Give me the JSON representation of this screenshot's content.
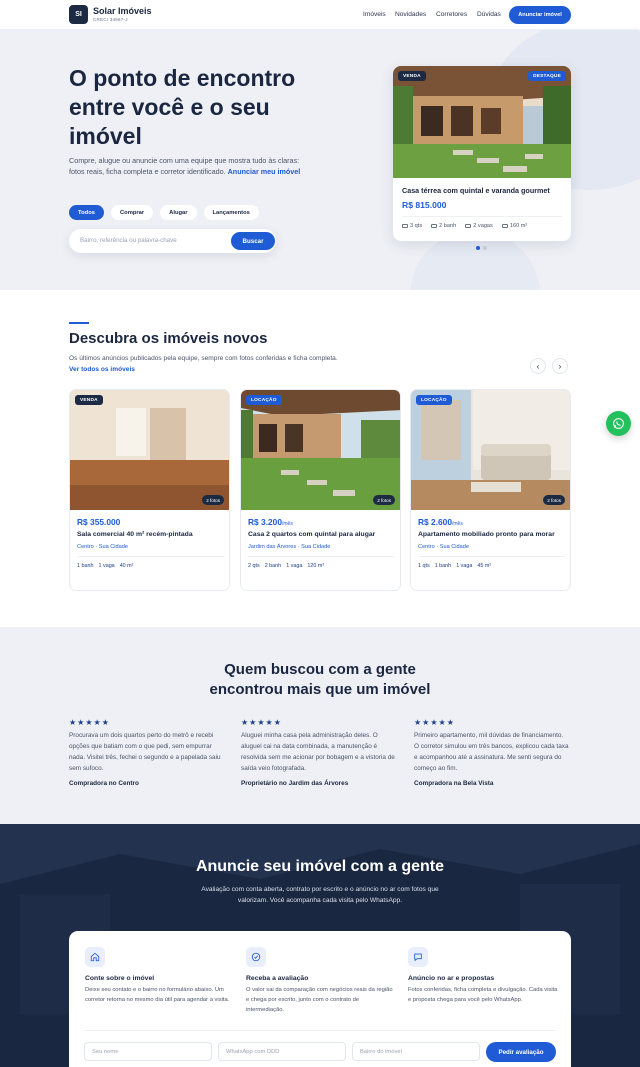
{
  "nav": {
    "logo": "SI",
    "brand": "Solar Imóveis",
    "creci": "CRECI 34567-J",
    "links": [
      "Imóveis",
      "Novidades",
      "Corretores",
      "Dúvidas"
    ],
    "cta": "Anunciar imóvel"
  },
  "hero": {
    "title": "O ponto de encontro entre você e o seu imóvel",
    "subtitle": "Compre, alugue ou anuncie com uma equipe que mostra tudo às claras: fotos reais, ficha completa e corretor identificado.",
    "subtitle_link": "Anunciar meu imóvel",
    "chips": [
      "Todos",
      "Comprar",
      "Alugar",
      "Lançamentos"
    ],
    "active_chip": "Todos",
    "search_placeholder": "Bairro, referência ou palavra-chave",
    "search_button": "Buscar",
    "featured": {
      "tag_left": "VENDA",
      "tag_right": "DESTAQUE",
      "title": "Casa térrea com quintal e varanda gourmet",
      "price": "R$ 815.000",
      "specs": [
        "3 qts",
        "2 banh",
        "2 vagas",
        "160 m²"
      ]
    },
    "carousel_dots": 2,
    "carousel_active": 0
  },
  "listings": {
    "title": "Descubra os imóveis novos",
    "subtitle": "Os últimos anúncios publicados pela equipe, sempre com fotos conferidas e ficha completa.",
    "subtitle_link": "Ver todos os imóveis",
    "prev_icon": "chevron-left-icon",
    "next_icon": "chevron-right-icon",
    "cards": [
      {
        "tag": "VENDA",
        "photos": "2 fotos",
        "price": "R$ 355.000",
        "price_suffix": "",
        "title": "Sala comercial 40 m² recém-pintada",
        "location": "Centro · Sua Cidade",
        "specs": [
          "1 banh",
          "1 vaga",
          "40 m²"
        ]
      },
      {
        "tag": "LOCAÇÃO",
        "photos": "2 fotos",
        "price": "R$ 3.200",
        "price_suffix": "/mês",
        "title": "Casa 2 quartos com quintal para alugar",
        "location": "Jardim das Árvores · Sua Cidade",
        "specs": [
          "2 qts",
          "2 banh",
          "1 vaga",
          "120 m²"
        ]
      },
      {
        "tag": "LOCAÇÃO",
        "photos": "2 fotos",
        "price": "R$ 2.600",
        "price_suffix": "/mês",
        "title": "Apartamento mobiliado pronto para morar",
        "location": "Centro · Sua Cidade",
        "specs": [
          "1 qts",
          "1 banh",
          "1 vaga",
          "45 m²"
        ]
      }
    ]
  },
  "whatsapp": {
    "icon": "whatsapp-icon"
  },
  "testimonials": {
    "title": "Quem buscou com a gente encontrou mais que um imóvel",
    "stars": "★★★★★",
    "items": [
      {
        "quote": "Procurava um dois quartos perto do metrô e recebi opções que batiam com o que pedi, sem empurrar nada. Visitei três, fechei o segundo e a papelada saiu sem sufoco.",
        "author": "Compradora no Centro"
      },
      {
        "quote": "Aluguei minha casa pela administração deles. O aluguel cai na data combinada, a manutenção é resolvida sem me acionar por bobagem e a vistoria de saída veio fotografada.",
        "author": "Proprietário no Jardim das Árvores"
      },
      {
        "quote": "Primeiro apartamento, mil dúvidas de financiamento. O corretor simulou em três bancos, explicou cada taxa e acompanhou até a assinatura. Me senti segura do começo ao fim.",
        "author": "Compradora na Bela Vista"
      }
    ]
  },
  "cta": {
    "title": "Anuncie seu imóvel com a gente",
    "subtitle": "Avaliação com conta aberta, contrato por escrito e o anúncio no ar com fotos que valorizam. Você acompanha cada visita pelo WhatsApp.",
    "steps": [
      {
        "icon": "home-icon",
        "title": "Conte sobre o imóvel",
        "desc": "Deixe seu contato e o bairro no formulário abaixo. Um corretor retorna no mesmo dia útil para agendar a visita."
      },
      {
        "icon": "check-circle-icon",
        "title": "Receba a avaliação",
        "desc": "O valor sai da comparação com negócios reais da região e chega por escrito, junto com o contrato de intermediação."
      },
      {
        "icon": "chat-bubble-icon",
        "title": "Anúncio no ar e propostas",
        "desc": "Fotos conferidas, ficha completa e divulgação. Cada visita e proposta chega para você pelo WhatsApp."
      }
    ],
    "form": {
      "name_placeholder": "Seu nome",
      "whatsapp_placeholder": "WhatsApp com DDD",
      "district_placeholder": "Bairro do imóvel",
      "button": "Pedir avaliação"
    }
  }
}
